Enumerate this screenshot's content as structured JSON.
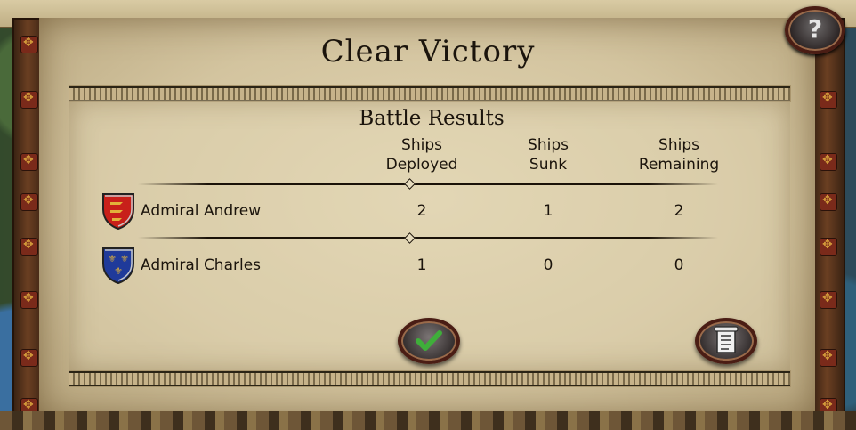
{
  "dialog": {
    "title": "Clear Victory",
    "help_label": "?"
  },
  "results": {
    "heading": "Battle Results",
    "columns": [
      {
        "line1": "Ships",
        "line2": "Deployed"
      },
      {
        "line1": "Ships",
        "line2": "Sunk"
      },
      {
        "line1": "Ships",
        "line2": "Remaining"
      }
    ],
    "rows": [
      {
        "name": "Admiral Andrew",
        "crest": "england-crest-icon",
        "deployed": "2",
        "sunk": "1",
        "remaining": "2"
      },
      {
        "name": "Admiral Charles",
        "crest": "france-crest-icon",
        "deployed": "1",
        "sunk": "0",
        "remaining": "0"
      }
    ]
  },
  "buttons": {
    "confirm": "checkmark-icon",
    "log": "scroll-icon"
  },
  "colors": {
    "parchment": "#d3c49f",
    "ink": "#1b140c",
    "button_frame": "#4a1d14",
    "check_green": "#3fae3a",
    "england_red": "#c8201a",
    "france_blue": "#1f3a9a",
    "gold": "#e2b23a"
  }
}
